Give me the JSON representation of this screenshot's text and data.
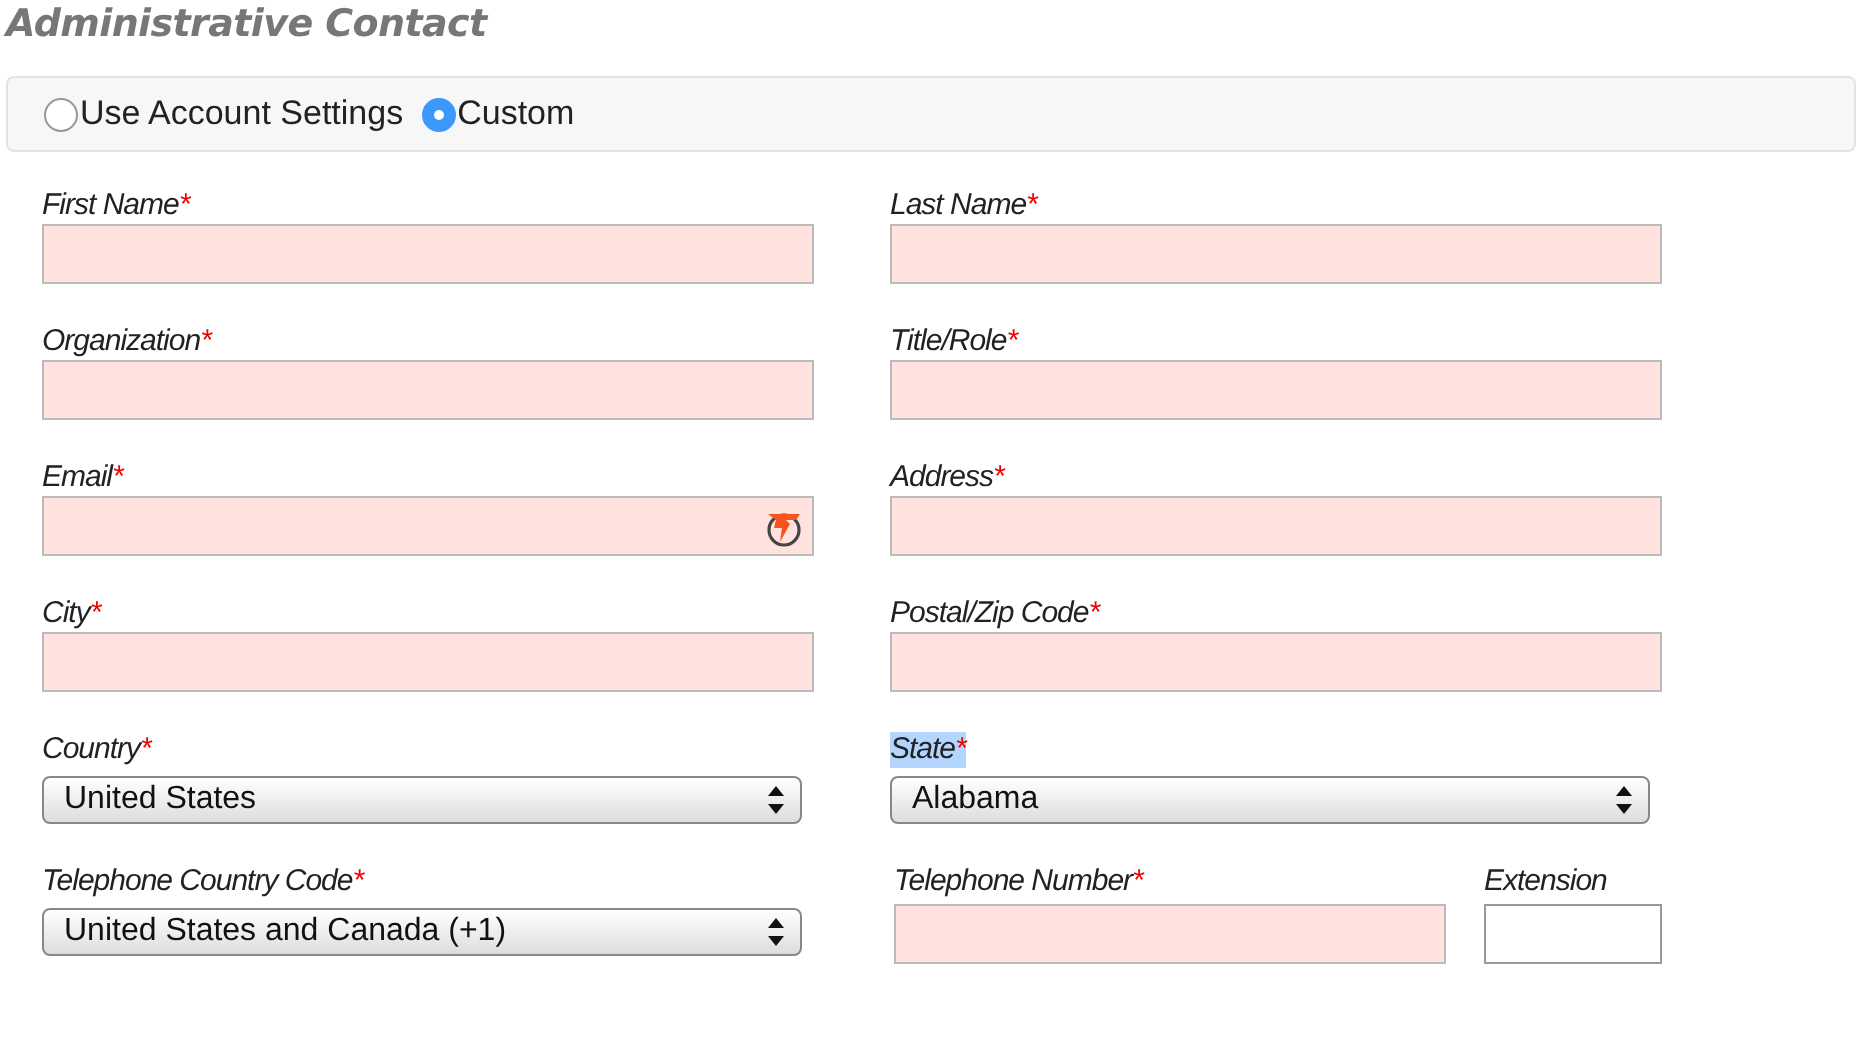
{
  "heading": "Administrative Contact",
  "contact_source": [
    {
      "label": "Use Account Settings",
      "selected": false
    },
    {
      "label": "Custom",
      "selected": true
    }
  ],
  "rows": [
    [
      [
        {
          "kind": "text",
          "label": "First Name",
          "required_mark": "*",
          "highlighted": false
        }
      ],
      [
        {
          "kind": "text",
          "label": "Last Name",
          "required_mark": "*",
          "highlighted": false
        }
      ]
    ],
    [
      [
        {
          "kind": "text",
          "label": "Organization",
          "required_mark": "*",
          "highlighted": false
        }
      ],
      [
        {
          "kind": "text",
          "label": "Title/Role",
          "required_mark": "*",
          "highlighted": false
        }
      ]
    ],
    [
      [
        {
          "kind": "email",
          "label": "Email",
          "required_mark": "*",
          "highlighted": false
        }
      ],
      [
        {
          "kind": "text",
          "label": "Address",
          "required_mark": "*",
          "highlighted": false
        }
      ]
    ],
    [
      [
        {
          "kind": "text",
          "label": "City",
          "required_mark": "*",
          "highlighted": false
        }
      ],
      [
        {
          "kind": "text",
          "label": "Postal/Zip Code",
          "required_mark": "*",
          "highlighted": false
        }
      ]
    ],
    [
      [
        {
          "kind": "select",
          "label": "Country",
          "required_mark": "*",
          "highlighted": false,
          "value": "United States"
        }
      ],
      [
        {
          "kind": "select",
          "label": "State",
          "required_mark": "*",
          "highlighted": true,
          "value": "Alabama"
        }
      ]
    ],
    [
      [
        {
          "kind": "select",
          "label": "Telephone Country Code",
          "required_mark": "*",
          "highlighted": false,
          "value": "United States and Canada (+1)"
        }
      ],
      [
        {
          "kind": "text",
          "label": "Telephone Number",
          "required_mark": "*",
          "highlighted": false
        },
        {
          "kind": "text",
          "label": "Extension",
          "highlighted": false
        }
      ]
    ]
  ]
}
